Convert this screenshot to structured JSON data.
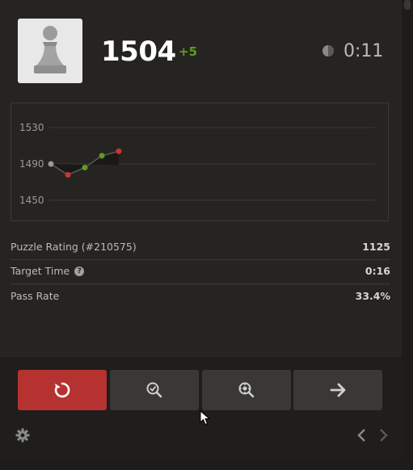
{
  "player": {
    "rating": "1504",
    "rating_delta": "+5",
    "timer": "0:11",
    "avatar_icon": "pawn-icon"
  },
  "chart_data": {
    "type": "line",
    "y_ticks": [
      "1530",
      "1490",
      "1450"
    ],
    "ylim": [
      1440,
      1540
    ],
    "points": [
      {
        "x": 0,
        "y": 1490,
        "color": "#9a9a9a"
      },
      {
        "x": 1,
        "y": 1478,
        "color": "#c33"
      },
      {
        "x": 2,
        "y": 1486,
        "color": "#629924"
      },
      {
        "x": 3,
        "y": 1499,
        "color": "#629924"
      },
      {
        "x": 4,
        "y": 1504,
        "color": "#c33"
      }
    ]
  },
  "stats": [
    {
      "label": "Puzzle Rating (#210575)",
      "value": "1125"
    },
    {
      "label": "Target Time",
      "value": "0:16",
      "help": "?"
    },
    {
      "label": "Pass Rate",
      "value": "33.4%"
    }
  ],
  "buttons": {
    "retry_icon": "retry-icon",
    "analysis_icon": "analyze-icon",
    "engine_icon": "engine-analysis-icon",
    "next_icon": "arrow-right-icon"
  },
  "colors": {
    "background": "#262421",
    "retry_button": "#b63230",
    "button": "#3a3836",
    "positive": "#629924"
  }
}
